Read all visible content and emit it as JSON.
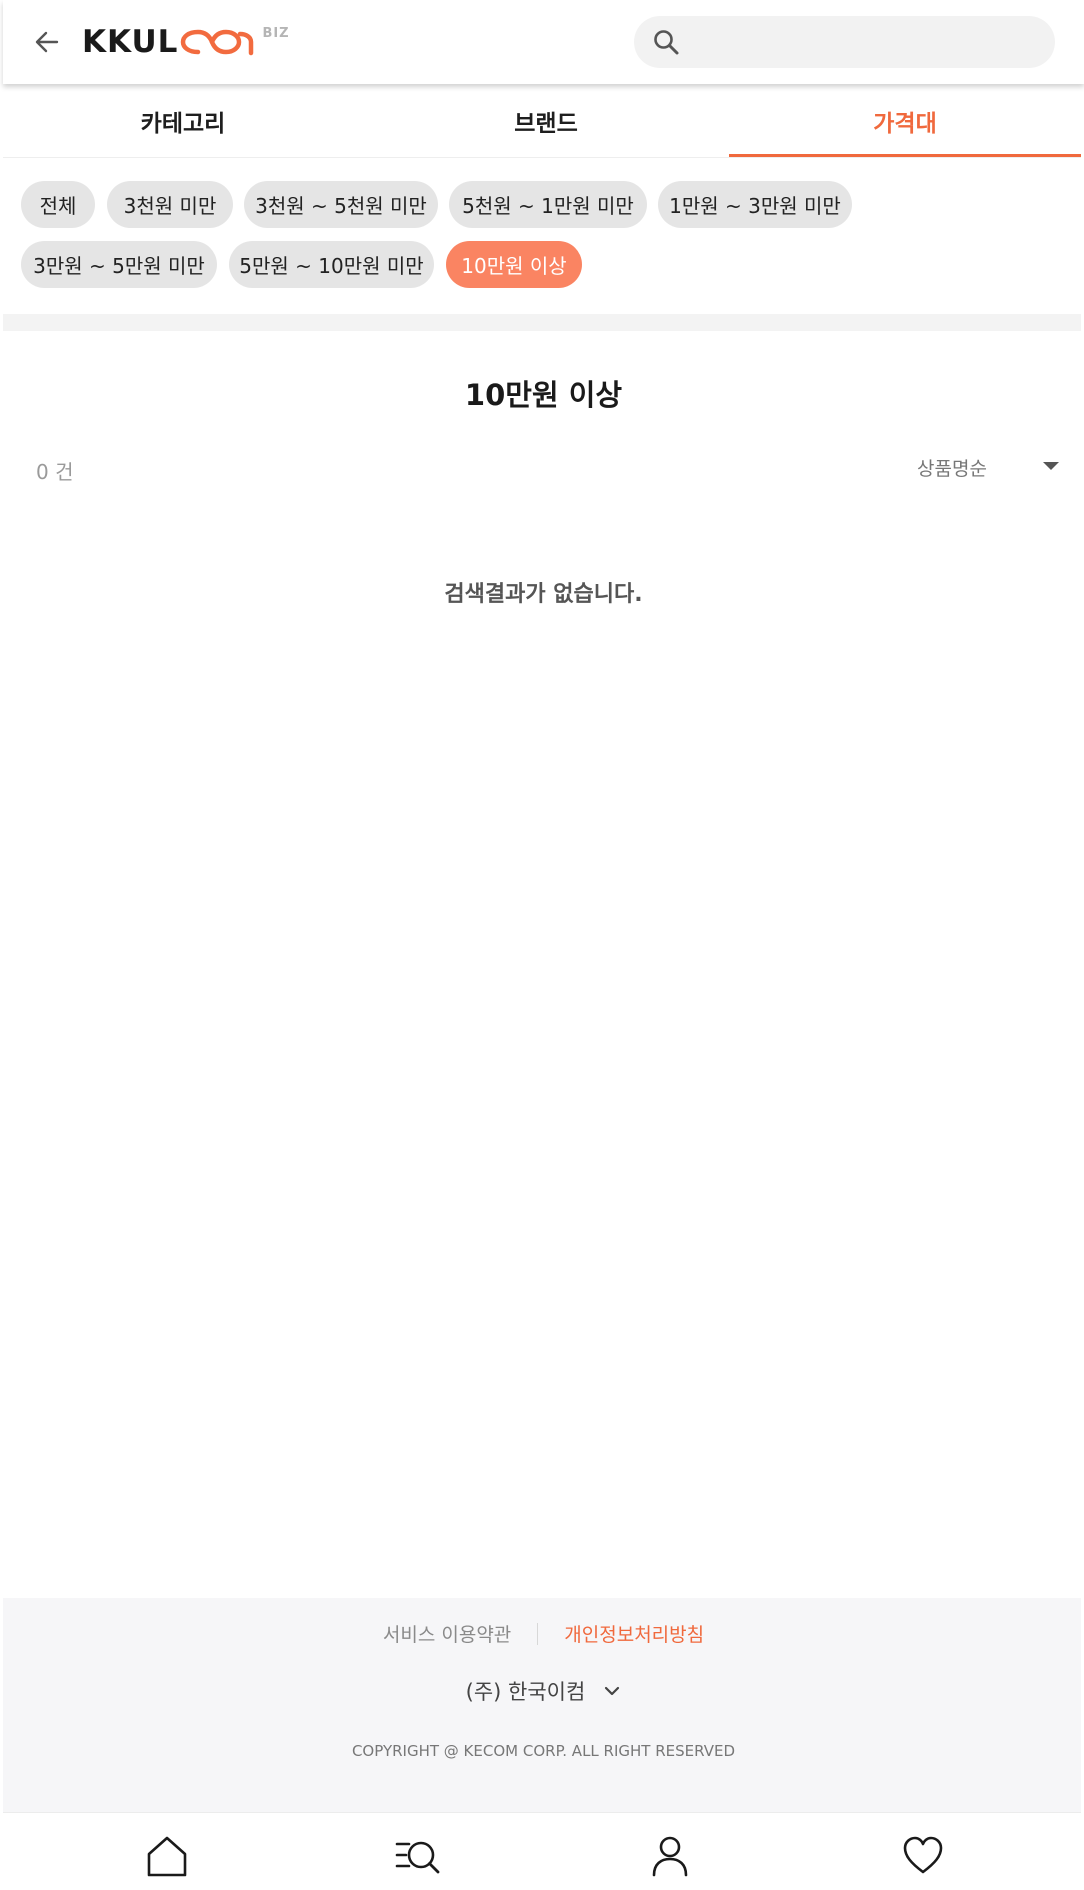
{
  "header": {
    "back_icon": "arrow-left-icon",
    "logo_text": "KKUL",
    "logo_suffix": "BIZ",
    "search": {
      "placeholder": "",
      "value": "",
      "icon": "search-icon"
    }
  },
  "tabs": [
    {
      "label": "카테고리",
      "active": false
    },
    {
      "label": "브랜드",
      "active": false
    },
    {
      "label": "가격대",
      "active": true
    }
  ],
  "price_filters": [
    {
      "label": "전체",
      "active": false
    },
    {
      "label": "3천원 미만",
      "active": false
    },
    {
      "label": "3천원 ~ 5천원 미만",
      "active": false
    },
    {
      "label": "5천원 ~ 1만원 미만",
      "active": false
    },
    {
      "label": "1만원 ~ 3만원 미만",
      "active": false
    },
    {
      "label": "3만원 ~ 5만원 미만",
      "active": false
    },
    {
      "label": "5만원 ~ 10만원 미만",
      "active": false
    },
    {
      "label": "10만원 이상",
      "active": true
    }
  ],
  "results": {
    "title": "10만원 이상",
    "count": "0 건",
    "sort": {
      "selected": "상품명순"
    },
    "empty_message": "검색결과가 없습니다."
  },
  "footer": {
    "terms_link": "서비스 이용약관",
    "privacy_link": "개인정보처리방침",
    "company": "(주) 한국이컴",
    "copyright": "COPYRIGHT @ KECOM CORP. ALL RIGHT RESERVED"
  },
  "bottom_nav": [
    {
      "icon": "home-icon"
    },
    {
      "icon": "category-search-icon"
    },
    {
      "icon": "user-icon"
    },
    {
      "icon": "heart-icon"
    }
  ],
  "colors": {
    "accent": "#f0693d",
    "chip_active": "#fa8462",
    "chip_default": "#e5e5e5",
    "separator": "#f3f3f3",
    "footer_bg": "#f6f6f8"
  }
}
